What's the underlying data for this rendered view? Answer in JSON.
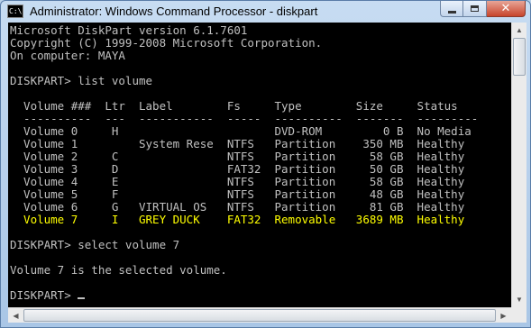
{
  "window": {
    "title": "Administrator: Windows Command Processor - diskpart",
    "icon_label": "C:\\",
    "close_glyph": "✕"
  },
  "console": {
    "lines": [
      "Microsoft DiskPart version 6.1.7601",
      "Copyright (C) 1999-2008 Microsoft Corporation.",
      "On computer: MAYA",
      "",
      "DISKPART> list volume",
      "",
      "  Volume ###  Ltr  Label        Fs     Type        Size     Status",
      "  ----------  ---  -----------  -----  ----------  -------  ---------",
      "  Volume 0     H                       DVD-ROM         0 B  No Media",
      "  Volume 1         System Rese  NTFS   Partition    350 MB  Healthy",
      "  Volume 2     C                NTFS   Partition     58 GB  Healthy",
      "  Volume 3     D                FAT32  Partition     50 GB  Healthy",
      "  Volume 4     E                NTFS   Partition     58 GB  Healthy",
      "  Volume 5     F                NTFS   Partition     48 GB  Healthy",
      "  Volume 6     G   VIRTUAL OS   NTFS   Partition     81 GB  Healthy",
      "  Volume 7     I   GREY DUCK    FAT32  Removable   3689 MB  Healthy",
      "",
      "DISKPART> select volume 7",
      "",
      "Volume 7 is the selected volume.",
      "",
      "DISKPART> "
    ],
    "highlight_color": "#ffff00",
    "text_color": "#c0c0c0",
    "background": "#000000"
  },
  "icons": {
    "app": "cmd-icon",
    "minimize": "minimize-icon",
    "maximize": "maximize-icon",
    "close": "close-icon",
    "scroll_up": "scroll-up-arrow-icon",
    "scroll_down": "scroll-down-arrow-icon",
    "scroll_left": "scroll-left-arrow-icon",
    "scroll_right": "scroll-right-arrow-icon"
  }
}
